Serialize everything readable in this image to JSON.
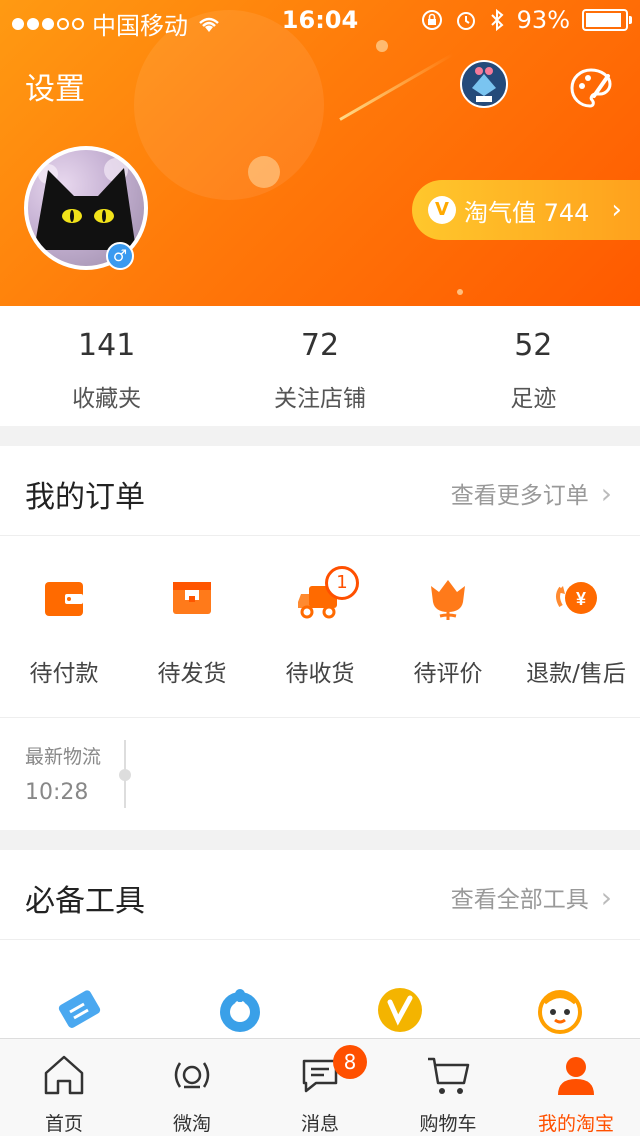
{
  "status": {
    "carrier": "中国移动",
    "time": "16:04",
    "battery": "93%",
    "battery_level": 0.93
  },
  "header": {
    "settings_label": "设置",
    "taoqi_label": "淘气值 744",
    "taoqi_icon": "v-icon",
    "arrow": "›"
  },
  "stats": [
    {
      "num": "141",
      "label": "收藏夹"
    },
    {
      "num": "72",
      "label": "关注店铺"
    },
    {
      "num": "52",
      "label": "足迹"
    }
  ],
  "orders": {
    "title": "我的订单",
    "more": "查看更多订单",
    "items": [
      {
        "label": "待付款",
        "icon": "wallet-icon"
      },
      {
        "label": "待发货",
        "icon": "box-icon"
      },
      {
        "label": "待收货",
        "icon": "truck-icon"
      },
      {
        "label": "待评价",
        "icon": "flower-icon"
      },
      {
        "label": "退款/售后",
        "icon": "refund-icon"
      }
    ],
    "receive_count": "1",
    "logistics_title": "最新物流",
    "logistics_time": "10:28"
  },
  "tools": {
    "title": "必备工具",
    "more": "查看全部工具"
  },
  "tabbar": [
    {
      "label": "首页",
      "icon": "home-icon"
    },
    {
      "label": "微淘",
      "icon": "broadcast-icon"
    },
    {
      "label": "消息",
      "icon": "message-icon"
    },
    {
      "label": "购物车",
      "icon": "cart-icon"
    },
    {
      "label": "我的淘宝",
      "icon": "person-icon"
    }
  ],
  "message_badge": "8",
  "colors": {
    "brand": "#ff5000",
    "header_start": "#ff9a12",
    "header_end": "#ff5a00"
  }
}
